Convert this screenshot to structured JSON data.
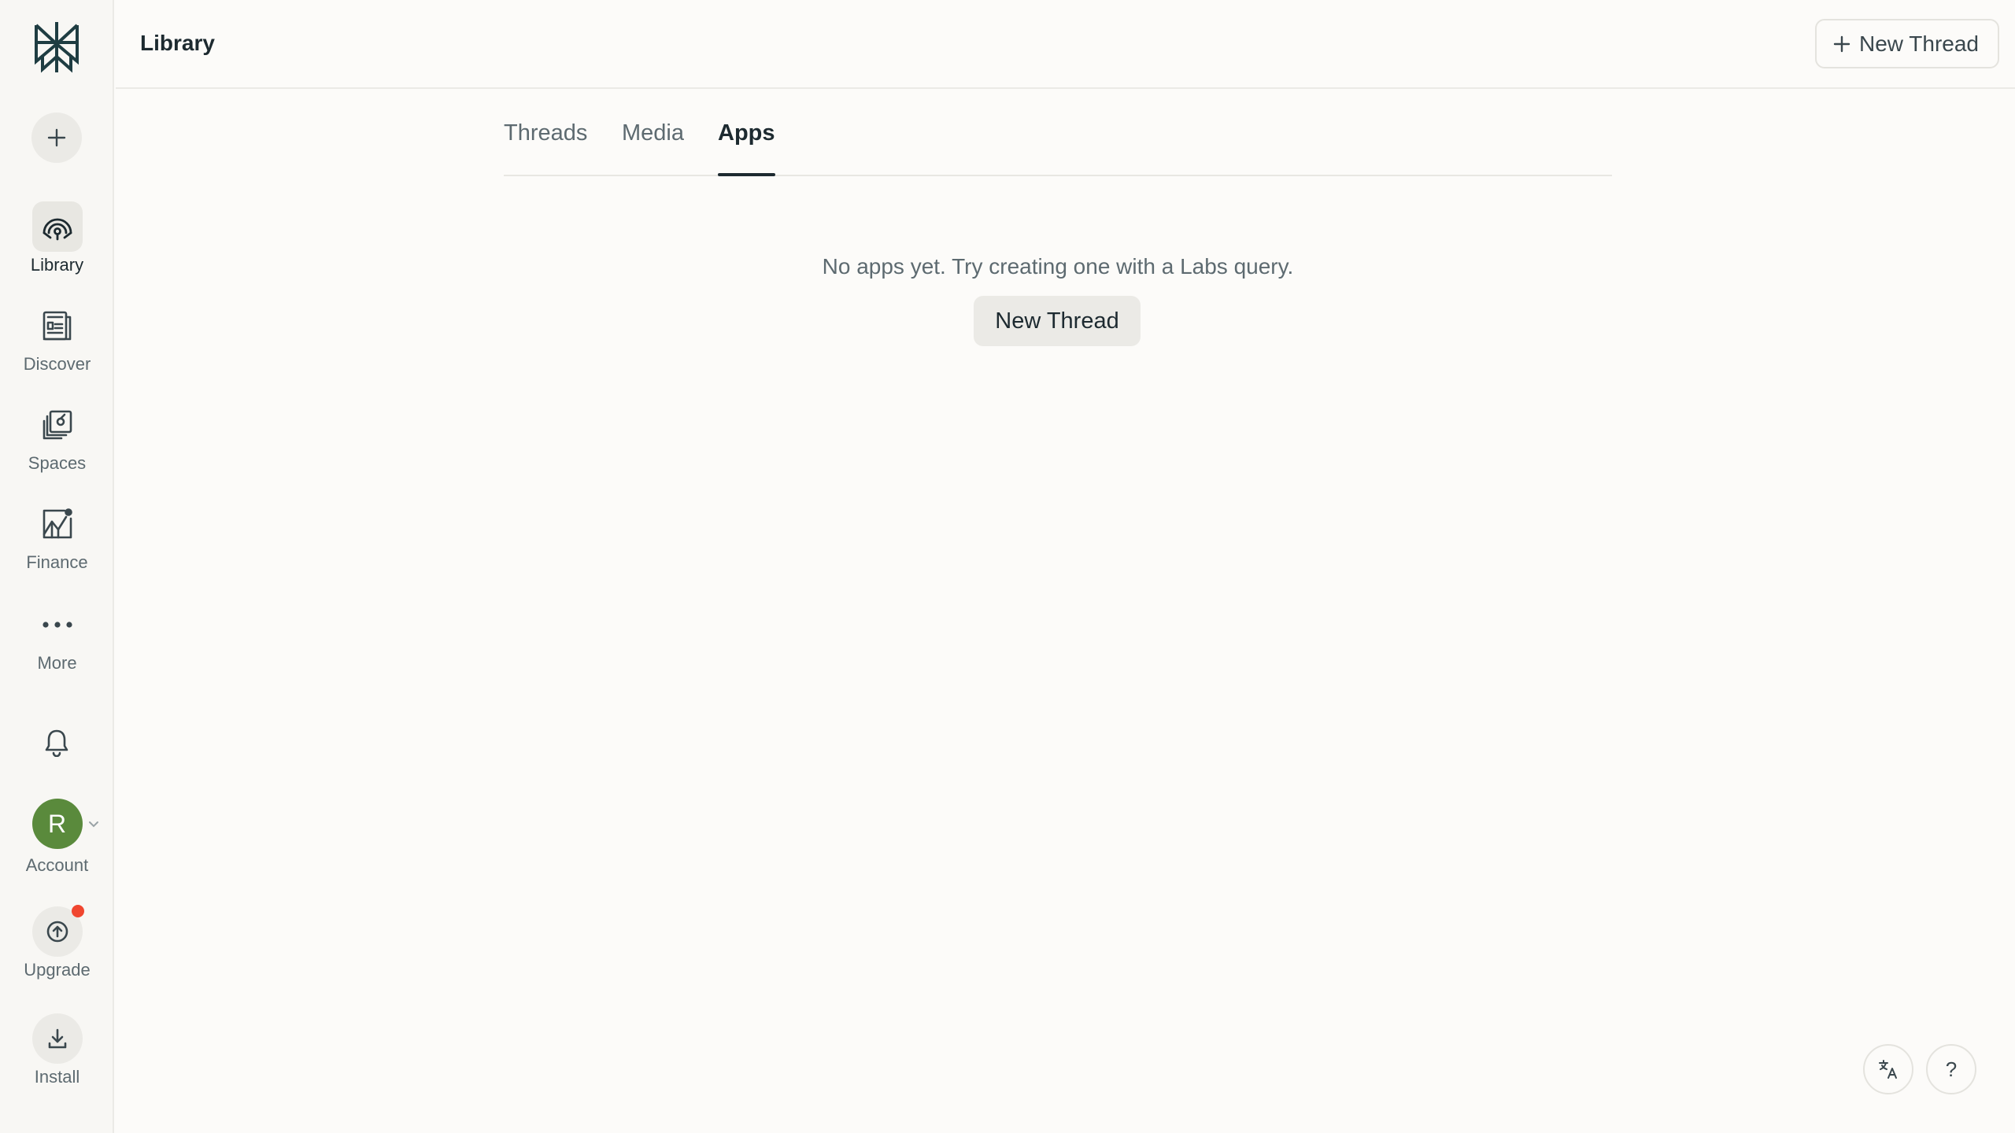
{
  "header": {
    "title": "Library",
    "new_thread_label": "New Thread"
  },
  "sidebar": {
    "logo_icon": "perplexity-logo-icon",
    "new_icon": "plus-icon",
    "items": [
      {
        "label": "Library",
        "icon": "library-icon",
        "active": true
      },
      {
        "label": "Discover",
        "icon": "discover-icon"
      },
      {
        "label": "Spaces",
        "icon": "spaces-icon"
      },
      {
        "label": "Finance",
        "icon": "finance-icon"
      },
      {
        "label": "More",
        "icon": "more-dots-icon"
      }
    ],
    "notifications_icon": "bell-icon",
    "account": {
      "avatar_letter": "R",
      "label": "Account",
      "avatar_color": "#5a8a3c"
    },
    "upgrade": {
      "label": "Upgrade",
      "badge_color": "#f0462f"
    },
    "install": {
      "label": "Install"
    }
  },
  "tabs": [
    {
      "label": "Threads"
    },
    {
      "label": "Media"
    },
    {
      "label": "Apps",
      "active": true
    }
  ],
  "empty_state": {
    "message": "No apps yet. Try creating one with a Labs query.",
    "button_label": "New Thread"
  },
  "corner": {
    "language_icon": "translate-icon",
    "help_label": "?"
  }
}
